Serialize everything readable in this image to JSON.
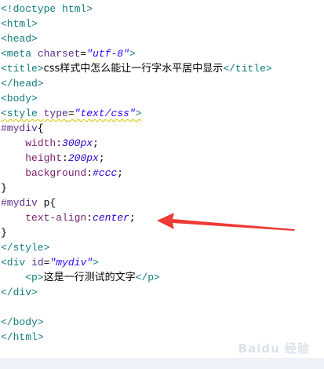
{
  "code": {
    "l1": {
      "tag": "<!doctype html>"
    },
    "l2": {
      "tag": "<html>"
    },
    "l3": {
      "tag": "<head>"
    },
    "l4": {
      "open": "<meta ",
      "attr": "charset",
      "eq": "=",
      "val": "\"utf-8\"",
      "close": ">"
    },
    "l5": {
      "open": "<title>",
      "text": "css样式中怎么能让一行字水平居中显示",
      "close": "</title>"
    },
    "l6": {
      "tag": "</head>"
    },
    "l7": {
      "tag": "<body>"
    },
    "l8": {
      "open": "<style ",
      "attr": "type",
      "eq": "=",
      "val": "\"text/css\"",
      "close": ">"
    },
    "l9": {
      "selector": "#mydiv",
      "brace": "{"
    },
    "l10": {
      "indent": "    ",
      "prop": "width",
      "colon": ":",
      "val": "300px",
      "semi": ";"
    },
    "l11": {
      "indent": "    ",
      "prop": "height",
      "colon": ":",
      "val": "200px",
      "semi": ";"
    },
    "l12": {
      "indent": "    ",
      "prop": "background",
      "colon": ":",
      "val": "#ccc",
      "semi": ";"
    },
    "l13": {
      "brace": "}"
    },
    "l14": {
      "selector": "#mydiv ",
      "sel2": "p",
      "brace": "{"
    },
    "l15": {
      "indent": "    ",
      "prop": "text-align",
      "colon": ":",
      "val": "center",
      "semi": ";"
    },
    "l16": {
      "brace": "}"
    },
    "l17": {
      "tag": "</style>"
    },
    "l18": {
      "open": "<div ",
      "attr": "id",
      "eq": "=",
      "val": "\"mydiv\"",
      "close": ">"
    },
    "l19": {
      "indent": "    ",
      "open": "<p>",
      "text": "这是一行测试的文字",
      "close": "</p>"
    },
    "l20": {
      "tag": "</div>"
    },
    "l21": {
      "tag": ""
    },
    "l22": {
      "tag": "</body>"
    },
    "l23": {
      "tag": "</html>"
    }
  },
  "watermark": "Baidu 经验",
  "colors": {
    "arrow": "#ee3b34",
    "footer": "#edf2f8"
  }
}
